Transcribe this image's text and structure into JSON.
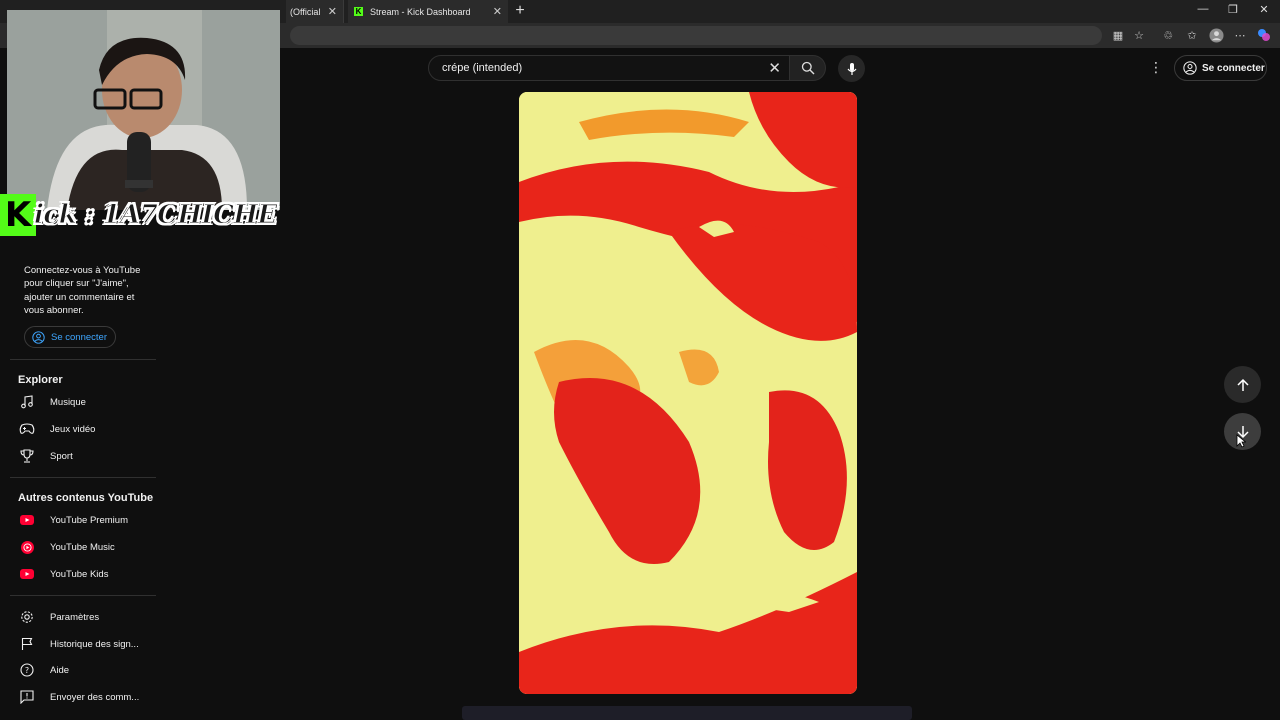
{
  "browser": {
    "tabs": [
      {
        "title": "(Official M"
      },
      {
        "title": "Stream - Kick Dashboard"
      }
    ],
    "new_tab": "+",
    "window_controls": {
      "minimize": "—",
      "restore": "❐",
      "close": "✕"
    }
  },
  "header": {
    "search_value": "crépe (intended)",
    "clear_icon": "close-icon",
    "search_icon": "search-icon",
    "mic_icon": "mic-icon",
    "more_icon": "⋮",
    "signin_label": "Se connecter"
  },
  "sidebar": {
    "signin_message": "Connectez-vous à YouTube pour cliquer sur \"J'aime\", ajouter un commentaire et vous abonner.",
    "signin_label": "Se connecter",
    "explore_heading": "Explorer",
    "explore_items": [
      {
        "label": "Musique",
        "icon": "music-note-icon"
      },
      {
        "label": "Jeux vidéo",
        "icon": "gamepad-icon"
      },
      {
        "label": "Sport",
        "icon": "trophy-icon"
      }
    ],
    "more_heading": "Autres contenus YouTube",
    "more_items": [
      {
        "label": "YouTube Premium",
        "icon": "youtube-premium-icon"
      },
      {
        "label": "YouTube Music",
        "icon": "youtube-music-icon"
      },
      {
        "label": "YouTube Kids",
        "icon": "youtube-kids-icon"
      }
    ],
    "settings_items": [
      {
        "label": "Paramètres",
        "icon": "gear-icon"
      },
      {
        "label": "Historique des sign...",
        "icon": "flag-icon"
      },
      {
        "label": "Aide",
        "icon": "help-icon"
      },
      {
        "label": "Envoyer des comm...",
        "icon": "feedback-icon"
      }
    ]
  },
  "overlay": {
    "kick_logo": "K",
    "kick_channel": "ick : 1A7CHICHE"
  },
  "colors": {
    "background": "#0f0f0f",
    "accent_blue": "#3ea6ff",
    "kick_green": "#53fc18",
    "youtube_red": "#ff0033"
  }
}
